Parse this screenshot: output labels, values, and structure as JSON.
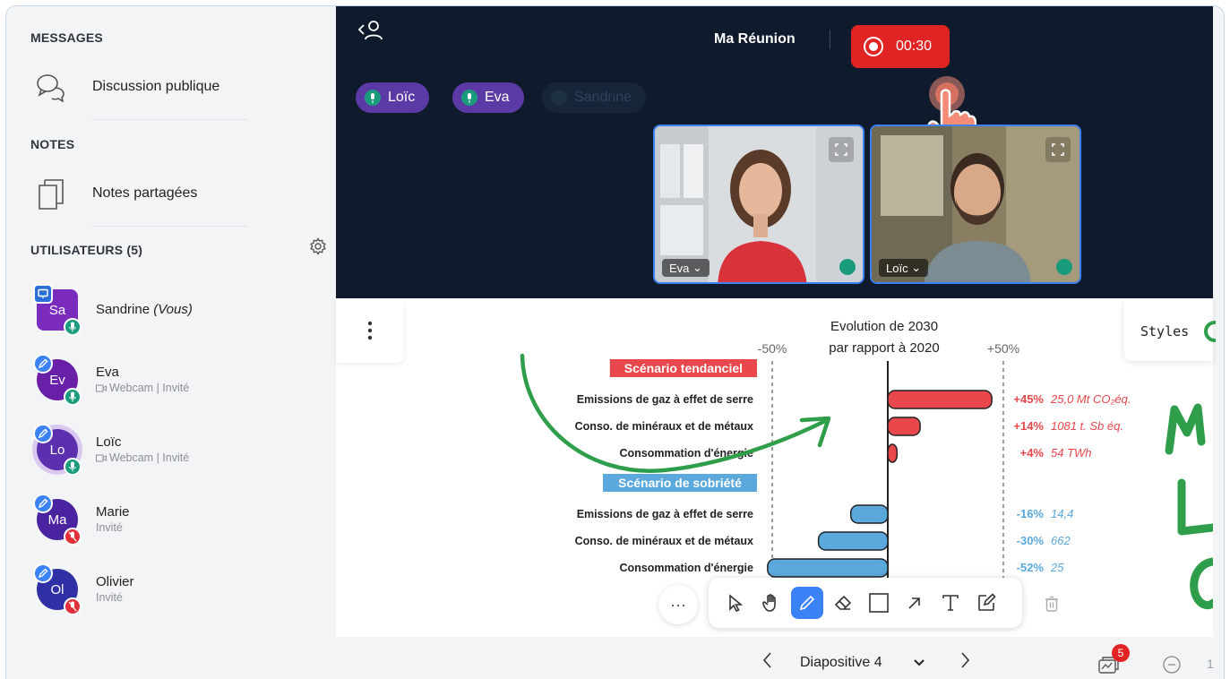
{
  "sidebar": {
    "messages_title": "MESSAGES",
    "public_chat_label": "Discussion publique",
    "notes_title": "NOTES",
    "shared_notes_label": "Notes partagées",
    "users_title": "UTILISATEURS (5)",
    "users": [
      {
        "initials": "Sa",
        "name": "Sandrine",
        "suffix": "(Vous)",
        "sub": "",
        "color": "#7b2cbf"
      },
      {
        "initials": "Ev",
        "name": "Eva",
        "suffix": "",
        "sub": "Webcam | Invité",
        "color": "#6a1fa8"
      },
      {
        "initials": "Lo",
        "name": "Loïc",
        "suffix": "",
        "sub": "Webcam | Invité",
        "color": "#5b2fae"
      },
      {
        "initials": "Ma",
        "name": "Marie",
        "suffix": "",
        "sub": "Invité",
        "color": "#4a23a0"
      },
      {
        "initials": "Ol",
        "name": "Olivier",
        "suffix": "",
        "sub": "Invité",
        "color": "#2f2fa6"
      }
    ]
  },
  "header": {
    "meeting_title": "Ma Réunion",
    "recording_time": "00:30",
    "talkers": [
      "Loïc",
      "Eva",
      "Sandrine"
    ]
  },
  "videos": [
    {
      "name": "Eva"
    },
    {
      "name": "Loïc"
    }
  ],
  "slide_panel": {
    "styles_label": "Styles"
  },
  "chart_data": {
    "type": "bar",
    "title": "Evolution de 2030 par rapport à 2020",
    "xaxis_ticks": [
      "-50%",
      "+50%"
    ],
    "groups": [
      {
        "name": "Scénario tendanciel",
        "color": "#e8474c",
        "categories": [
          "Emissions de gaz à effet de serre",
          "Conso. de minéraux et de métaux",
          "Consommation d'énergie"
        ],
        "values": [
          45,
          14,
          4
        ],
        "labels": [
          "+45%",
          "+14%",
          "+4%"
        ],
        "annotations": [
          "25,0 Mt CO₂éq.",
          "1081 t. Sb éq.",
          "54 TWh"
        ]
      },
      {
        "name": "Scénario de sobriété",
        "color": "#5aa8dc",
        "categories": [
          "Emissions de gaz à effet de serre",
          "Conso. de minéraux et de métaux",
          "Consommation d'énergie"
        ],
        "values": [
          -16,
          -30,
          -52
        ],
        "labels": [
          "-16%",
          "-30%",
          "-52%"
        ],
        "annotations": [
          "14,4",
          "662",
          "25"
        ]
      }
    ],
    "xlim": [
      -50,
      50
    ]
  },
  "bottom_bar": {
    "slide_label": "Diapositive 4",
    "slides_count": "5",
    "zoom_value": "1"
  }
}
